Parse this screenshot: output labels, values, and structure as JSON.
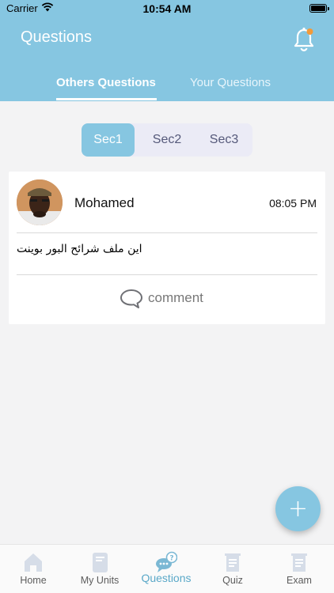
{
  "status_bar": {
    "carrier": "Carrier",
    "time": "10:54 AM"
  },
  "header": {
    "title": "Questions",
    "tabs": [
      {
        "label": "Others Questions",
        "active": true
      },
      {
        "label": "Your Questions",
        "active": false
      }
    ]
  },
  "sections": [
    {
      "label": "Sec1",
      "selected": true
    },
    {
      "label": "Sec2",
      "selected": false
    },
    {
      "label": "Sec3",
      "selected": false
    }
  ],
  "questions": [
    {
      "author": "Mohamed",
      "time": "08:05 PM",
      "text": "اين ملف شرائح البور بوينت",
      "comment_label": "comment"
    }
  ],
  "fab": {
    "label": "+"
  },
  "bottom_nav": [
    {
      "label": "Home",
      "icon": "home-icon",
      "active": false
    },
    {
      "label": "My Units",
      "icon": "book-icon",
      "active": false
    },
    {
      "label": "Questions",
      "icon": "question-chat-icon",
      "active": true
    },
    {
      "label": "Quiz",
      "icon": "quiz-icon",
      "active": false
    },
    {
      "label": "Exam",
      "icon": "exam-icon",
      "active": false
    }
  ],
  "colors": {
    "primary": "#86c6e1",
    "active_nav": "#5aa8c8",
    "background": "#f3f3f4",
    "notification_dot": "#f29a3a"
  }
}
